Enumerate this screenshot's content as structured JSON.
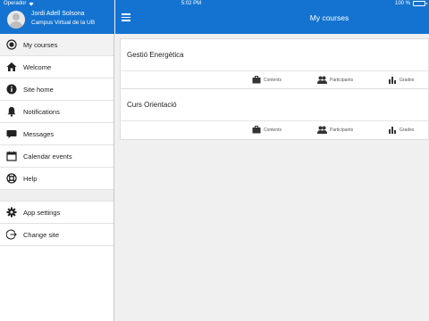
{
  "status_bar": {
    "carrier": "Operador",
    "time": "5:02 PM",
    "battery_text": "100 %"
  },
  "user": {
    "name": "Jordi Adell Solsona",
    "site": "Campus Virtual de la UB"
  },
  "menu": {
    "items": [
      {
        "label": "My courses",
        "icon": "record-icon"
      },
      {
        "label": "Welcome",
        "icon": "home-icon"
      },
      {
        "label": "Site home",
        "icon": "info-icon"
      },
      {
        "label": "Notifications",
        "icon": "bell-icon"
      },
      {
        "label": "Messages",
        "icon": "chat-icon"
      },
      {
        "label": "Calendar events",
        "icon": "calendar-icon"
      },
      {
        "label": "Help",
        "icon": "lifebuoy-icon"
      }
    ],
    "bottom_items": [
      {
        "label": "App settings",
        "icon": "gear-icon"
      },
      {
        "label": "Change site",
        "icon": "logout-icon"
      }
    ]
  },
  "header": {
    "title": "My courses"
  },
  "courses": [
    {
      "name": "Gestió Energètica",
      "actions": {
        "contents": "Contents",
        "participants": "Participants",
        "grades": "Grades"
      }
    },
    {
      "name": "Curs Orientació",
      "actions": {
        "contents": "Contents",
        "participants": "Participants",
        "grades": "Grades"
      }
    }
  ],
  "colors": {
    "accent": "#1473d0",
    "background": "#f0f0f0"
  }
}
